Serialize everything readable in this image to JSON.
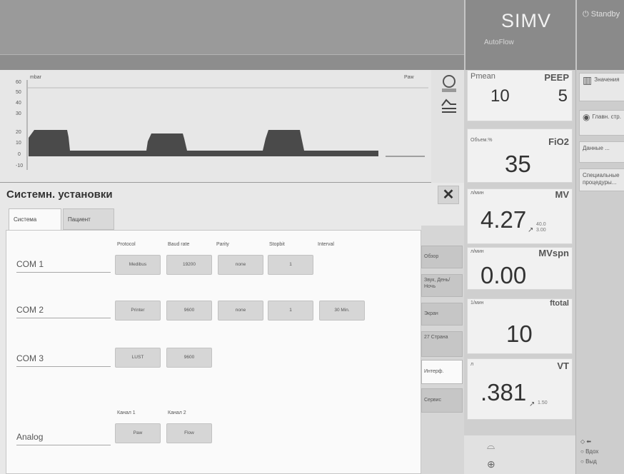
{
  "header": {
    "mode": "SIMV",
    "mode_sub": "AutoFlow",
    "standby": "Standby"
  },
  "waveform": {
    "unit": "mbar",
    "label": "Paw",
    "y_ticks": [
      "60",
      "50",
      "40",
      "30",
      "20",
      "10",
      "0",
      "-10"
    ]
  },
  "params": {
    "pmean": {
      "label": "Pmean",
      "value": "10"
    },
    "peep": {
      "label": "PEEP",
      "value": "5"
    },
    "fio2": {
      "label": "FiO2",
      "unit": "Объем.%",
      "value": "35"
    },
    "mv": {
      "label": "MV",
      "unit": "л/мин",
      "value": "4.27",
      "small_hi": "40.0",
      "small_lo": "3.00"
    },
    "mvspn": {
      "label": "MVspn",
      "unit": "л/мин",
      "value": "0.00"
    },
    "ftotal": {
      "label": "ftotal",
      "unit": "1/мин",
      "value": "10"
    },
    "vt": {
      "label": "VT",
      "unit": "л",
      "value": ".381",
      "small": "1.50"
    }
  },
  "right_menu": {
    "values": "Значения",
    "main": "Главн. стр.",
    "data": "Данные ...",
    "special": "Специальные процедуры..."
  },
  "dialog": {
    "title": "Системн. установки",
    "tabs": [
      "Система",
      "Пациент"
    ],
    "side_tabs": [
      "Обзор",
      "Звук, День/Ночь",
      "Экран",
      "27 Страна",
      "Интерф.",
      "Сервис"
    ],
    "columns": [
      "Protocol",
      "Baud rate",
      "Parity",
      "Stopbit",
      "Interval"
    ],
    "rows": [
      {
        "label": "COM 1",
        "values": [
          "Medibus",
          "19200",
          "none",
          "1"
        ]
      },
      {
        "label": "COM 2",
        "values": [
          "Printer",
          "9600",
          "none",
          "1",
          "30 Min."
        ]
      },
      {
        "label": "COM 3",
        "values": [
          "LUST",
          "9600"
        ]
      }
    ],
    "analog": {
      "label": "Analog",
      "columns": [
        "Канал 1",
        "Канал 2"
      ],
      "values": [
        "Paw",
        "Flow"
      ]
    }
  },
  "bottom": {
    "insp": "Вдох",
    "exp": "Выд"
  }
}
